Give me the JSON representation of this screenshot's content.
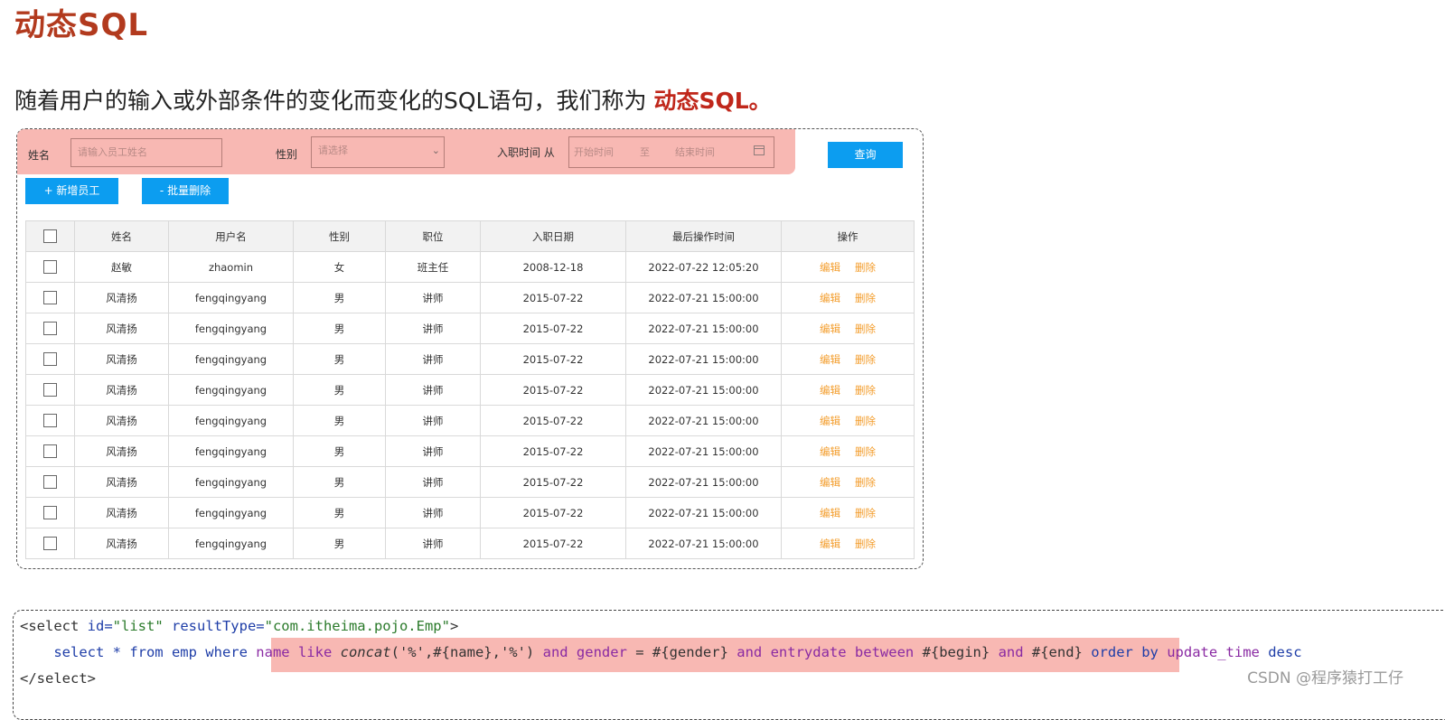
{
  "title": "动态SQL",
  "subtitle": {
    "text": "随着用户的输入或外部条件的变化而变化的SQL语句，我们称为 ",
    "accent": "动态SQL。"
  },
  "filters": {
    "name_label": "姓名",
    "name_placeholder": "请输入员工姓名",
    "gender_label": "性别",
    "gender_placeholder": "请选择",
    "date_label": "入职时间 从",
    "date_start": "开始时间",
    "date_sep": "至",
    "date_end": "结束时间",
    "query_button": "查询"
  },
  "actions": {
    "add": "+ 新增员工",
    "batch_delete": "- 批量删除"
  },
  "table": {
    "headers": [
      "姓名",
      "用户名",
      "性别",
      "职位",
      "入职日期",
      "最后操作时间",
      "操作"
    ],
    "ops": {
      "edit": "编辑",
      "delete": "删除"
    },
    "rows": [
      {
        "name": "赵敏",
        "username": "zhaomin",
        "gender": "女",
        "job": "班主任",
        "entry": "2008-12-18",
        "updated": "2022-07-22 12:05:20"
      },
      {
        "name": "风清扬",
        "username": "fengqingyang",
        "gender": "男",
        "job": "讲师",
        "entry": "2015-07-22",
        "updated": "2022-07-21 15:00:00"
      },
      {
        "name": "风清扬",
        "username": "fengqingyang",
        "gender": "男",
        "job": "讲师",
        "entry": "2015-07-22",
        "updated": "2022-07-21 15:00:00"
      },
      {
        "name": "风清扬",
        "username": "fengqingyang",
        "gender": "男",
        "job": "讲师",
        "entry": "2015-07-22",
        "updated": "2022-07-21 15:00:00"
      },
      {
        "name": "风清扬",
        "username": "fengqingyang",
        "gender": "男",
        "job": "讲师",
        "entry": "2015-07-22",
        "updated": "2022-07-21 15:00:00"
      },
      {
        "name": "风清扬",
        "username": "fengqingyang",
        "gender": "男",
        "job": "讲师",
        "entry": "2015-07-22",
        "updated": "2022-07-21 15:00:00"
      },
      {
        "name": "风清扬",
        "username": "fengqingyang",
        "gender": "男",
        "job": "讲师",
        "entry": "2015-07-22",
        "updated": "2022-07-21 15:00:00"
      },
      {
        "name": "风清扬",
        "username": "fengqingyang",
        "gender": "男",
        "job": "讲师",
        "entry": "2015-07-22",
        "updated": "2022-07-21 15:00:00"
      },
      {
        "name": "风清扬",
        "username": "fengqingyang",
        "gender": "男",
        "job": "讲师",
        "entry": "2015-07-22",
        "updated": "2022-07-21 15:00:00"
      },
      {
        "name": "风清扬",
        "username": "fengqingyang",
        "gender": "男",
        "job": "讲师",
        "entry": "2015-07-22",
        "updated": "2022-07-21 15:00:00"
      }
    ]
  },
  "code": {
    "line1": {
      "open": "<select ",
      "id_attr": "id=",
      "id_val": "\"list\"",
      "rt_attr": " resultType=",
      "rt_val": "\"com.itheima.pojo.Emp\"",
      "close": ">"
    },
    "line2": {
      "pre": "    select * from emp where ",
      "h1": "name like ",
      "h2": "concat",
      "h3": "('%',#{name},'%') ",
      "h4": "and gender",
      " h5": "",
      "h6": " = #{gender} ",
      "h7": "and entrydate between",
      "h8": " #{begin} ",
      "h9": "and",
      "h10": " #{end}",
      "post1": " order by ",
      "post2": "update_time",
      "post3": " desc"
    },
    "line3": "</select>"
  },
  "watermark": "CSDN @程序猿打工仔",
  "colors": {
    "accent": "#c0271b",
    "highlight": "#f8b8b3",
    "primary_button": "#0c9df0",
    "op_link": "#f39c2a"
  }
}
